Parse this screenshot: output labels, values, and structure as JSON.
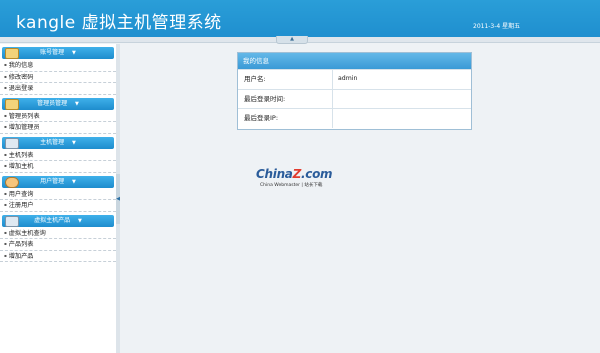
{
  "header": {
    "app_title": "kangle 虚拟主机管理系统",
    "date": "2011-3-4 星期五"
  },
  "sidebar": {
    "groups": [
      {
        "title": "账号管理",
        "items": [
          "我的信息",
          "修改密码",
          "退出登录"
        ]
      },
      {
        "title": "管理员管理",
        "items": [
          "管理员列表",
          "增加管理员"
        ]
      },
      {
        "title": "主机管理",
        "items": [
          "主机列表",
          "增加主机"
        ]
      },
      {
        "title": "用户管理",
        "items": [
          "用户查询",
          "注册用户"
        ]
      },
      {
        "title": "虚拟主机产品",
        "items": [
          "虚拟主机查询",
          "产品列表",
          "增加产品"
        ]
      }
    ]
  },
  "info_panel": {
    "title": "我的信息",
    "rows": [
      {
        "label": "用户名:",
        "value": "admin"
      },
      {
        "label": "最后登录时间:",
        "value": ""
      },
      {
        "label": "最后登录IP:",
        "value": ""
      }
    ]
  },
  "watermark": {
    "logo_main": "China",
    "logo_z": "Z",
    "logo_end": ".com",
    "sub": "China Webmaster | 站长下载"
  },
  "icons": {
    "group_icon": "folder-icon",
    "chevron": "chevron-down-icon",
    "collapse": "chevron-up-icon",
    "sidebar_toggle": "chevron-left-icon"
  },
  "colors": {
    "header": "#1f8fcf",
    "panel_title": "#3a9ad6",
    "group_header": "#1e8ccd"
  }
}
